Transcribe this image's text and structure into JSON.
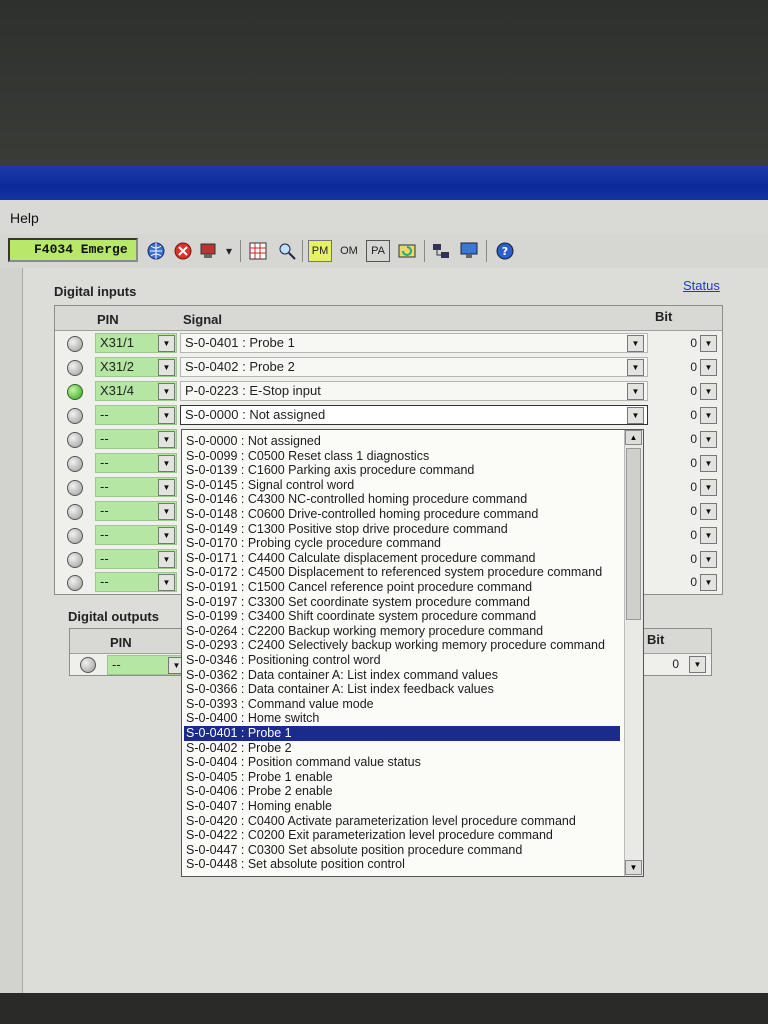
{
  "menu": {
    "help": "Help"
  },
  "toolbar": {
    "status_text": "F4034 Emerge",
    "pm_label": "PM",
    "om_label": "OM",
    "pa_label": "PA",
    "help_icon": "question-icon"
  },
  "status_link": "Status",
  "digital_inputs": {
    "title": "Digital inputs",
    "columns": {
      "pin": "PIN",
      "signal": "Signal",
      "bit": "Bit"
    },
    "rows": [
      {
        "led": "off",
        "pin": "X31/1",
        "signal": "S-0-0401 :  Probe 1",
        "bit": "0"
      },
      {
        "led": "off",
        "pin": "X31/2",
        "signal": "S-0-0402 :  Probe 2",
        "bit": "0"
      },
      {
        "led": "on",
        "pin": "X31/4",
        "signal": "P-0-0223 :  E-Stop input",
        "bit": "0"
      },
      {
        "led": "off",
        "pin": "--",
        "signal": "S-0-0000 :  Not assigned",
        "bit": "0"
      },
      {
        "led": "off",
        "pin": "--",
        "signal": "",
        "bit": "0"
      },
      {
        "led": "off",
        "pin": "--",
        "signal": "",
        "bit": "0"
      },
      {
        "led": "off",
        "pin": "--",
        "signal": "",
        "bit": "0"
      },
      {
        "led": "off",
        "pin": "--",
        "signal": "",
        "bit": "0"
      },
      {
        "led": "off",
        "pin": "--",
        "signal": "",
        "bit": "0"
      },
      {
        "led": "off",
        "pin": "--",
        "signal": "",
        "bit": "0"
      },
      {
        "led": "off",
        "pin": "--",
        "signal": "",
        "bit": "0"
      }
    ]
  },
  "digital_outputs": {
    "title": "Digital outputs",
    "columns": {
      "pin": "PIN",
      "bit": "Bit"
    },
    "rows": [
      {
        "led": "off",
        "pin": "--",
        "bit": "0"
      }
    ]
  },
  "dropdown": {
    "selected": "S-0-0401 :  Probe 1",
    "items": [
      "S-0-0000 :  Not assigned",
      "S-0-0099 :  C0500 Reset class 1 diagnostics",
      "S-0-0139 :  C1600 Parking axis procedure command",
      "S-0-0145 :  Signal control word",
      "S-0-0146 :  C4300 NC-controlled homing procedure command",
      "S-0-0148 :  C0600 Drive-controlled homing procedure command",
      "S-0-0149 :  C1300 Positive stop drive procedure command",
      "S-0-0170 :  Probing cycle procedure command",
      "S-0-0171 :  C4400 Calculate displacement procedure command",
      "S-0-0172 :  C4500 Displacement to referenced system procedure command",
      "S-0-0191 :  C1500 Cancel reference point procedure command",
      "S-0-0197 :  C3300 Set coordinate system procedure command",
      "S-0-0199 :  C3400 Shift coordinate system procedure command",
      "S-0-0264 :  C2200 Backup working memory procedure command",
      "S-0-0293 :  C2400 Selectively backup working memory procedure command",
      "S-0-0346 :  Positioning control word",
      "S-0-0362 :  Data container A: List index command values",
      "S-0-0366 :  Data container A: List index feedback values",
      "S-0-0393 :  Command value mode",
      "S-0-0400 :  Home switch",
      "S-0-0401 :  Probe 1",
      "S-0-0402 :  Probe 2",
      "S-0-0404 :  Position command value status",
      "S-0-0405 :  Probe 1 enable",
      "S-0-0406 :  Probe 2 enable",
      "S-0-0407 :  Homing enable",
      "S-0-0420 :  C0400 Activate parameterization level procedure command",
      "S-0-0422 :  C0200 Exit parameterization level procedure command",
      "S-0-0447 :  C0300 Set absolute position procedure command",
      "S-0-0448 :  Set absolute position control"
    ]
  }
}
